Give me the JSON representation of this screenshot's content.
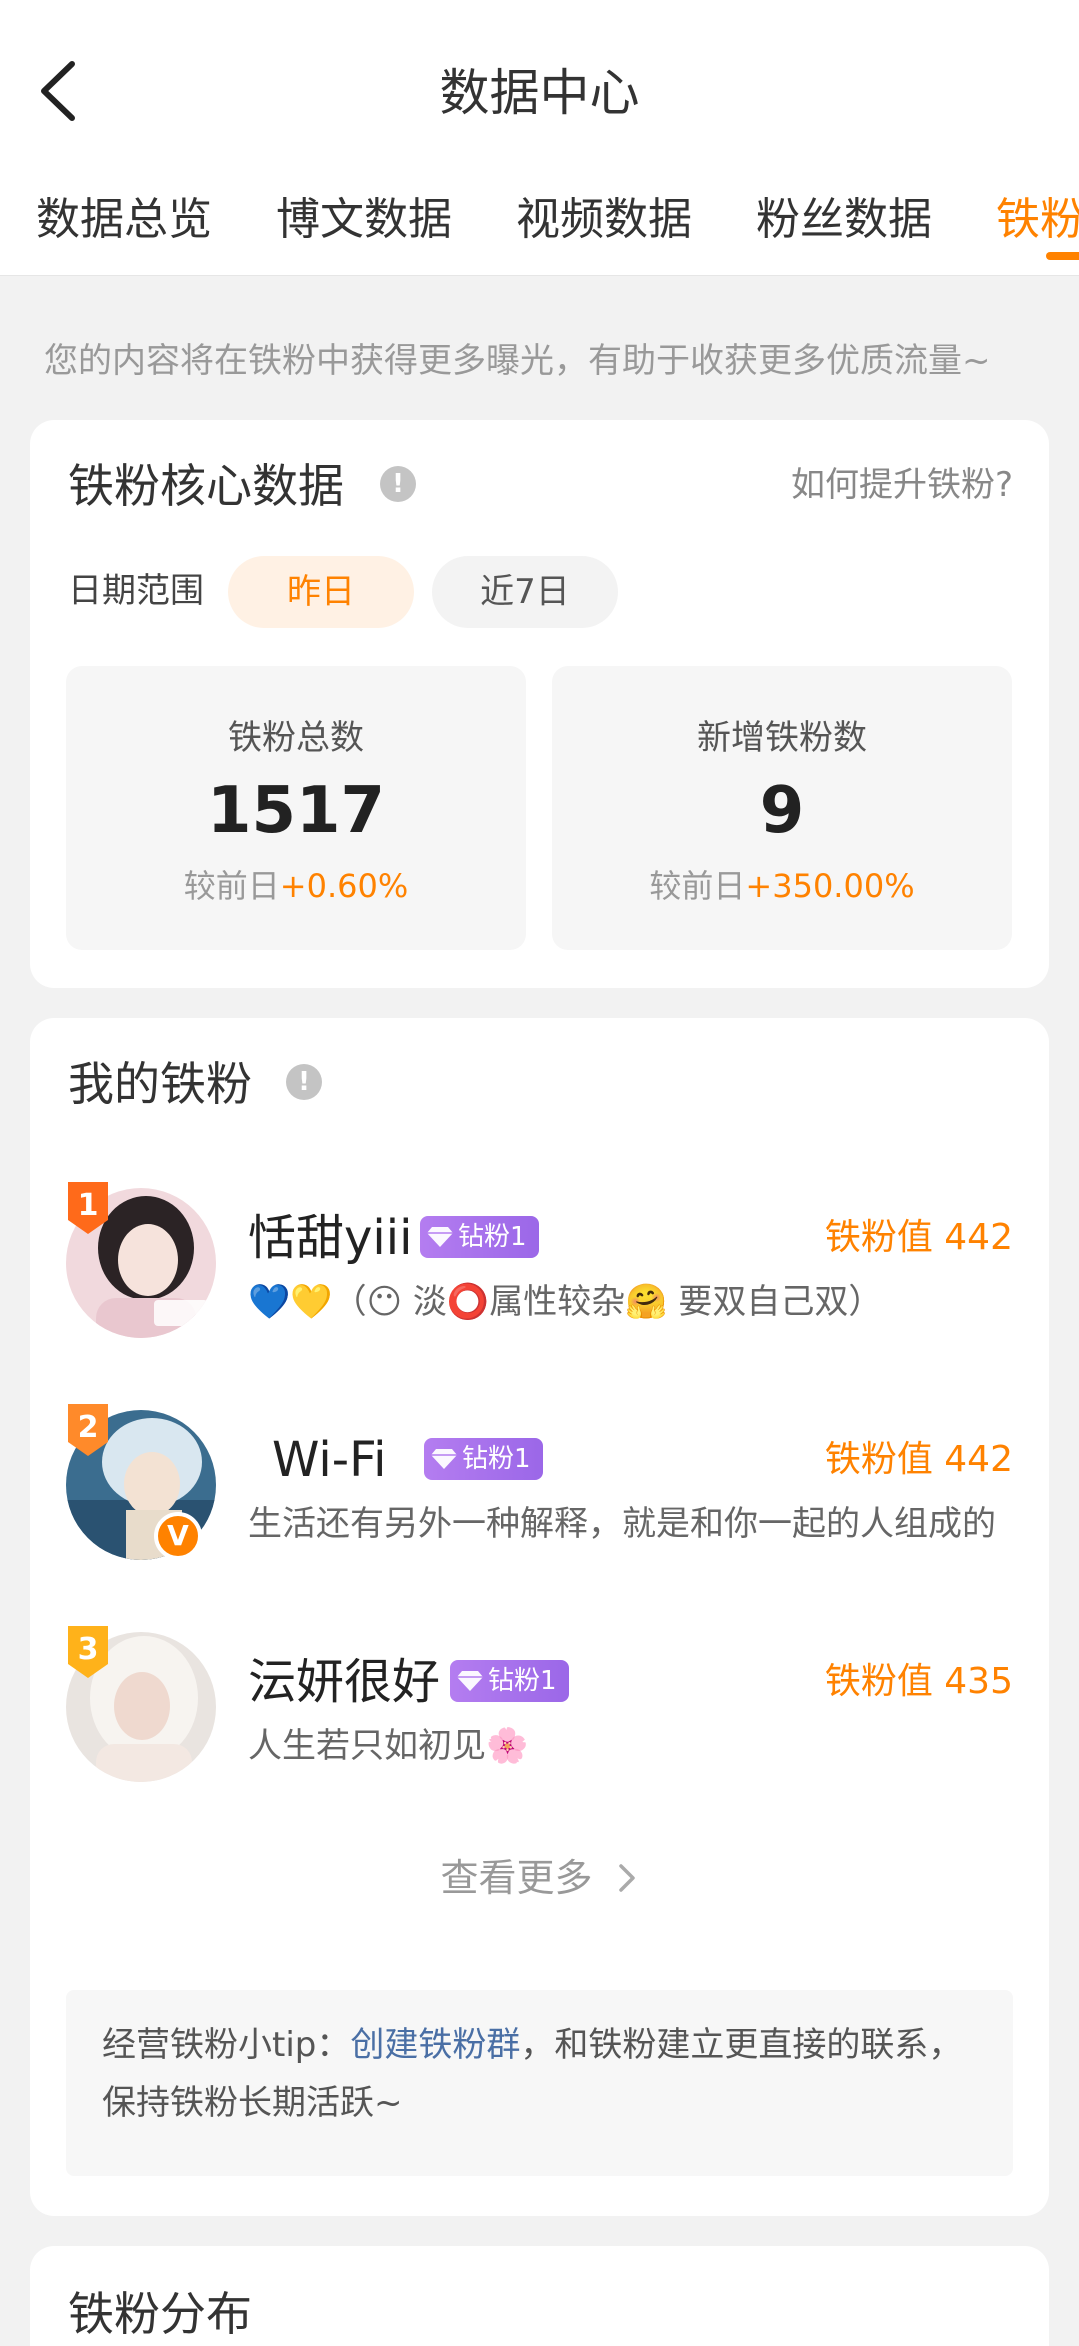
{
  "header": {
    "title": "数据中心"
  },
  "tabs": [
    {
      "label": "数据总览"
    },
    {
      "label": "博文数据"
    },
    {
      "label": "视频数据"
    },
    {
      "label": "粉丝数据"
    },
    {
      "label": "铁粉"
    }
  ],
  "notice": "您的内容将在铁粉中获得更多曝光，有助于收获更多优质流量~",
  "core": {
    "title": "铁粉核心数据",
    "info_glyph": "!",
    "how_link": "如何提升铁粉?",
    "range_label": "日期范围",
    "range_options": [
      "昨日",
      "近7日"
    ],
    "stats": [
      {
        "label": "铁粉总数",
        "value": "1517",
        "delta_prefix": "较前日",
        "delta": "+0.60%"
      },
      {
        "label": "新增铁粉数",
        "value": "9",
        "delta_prefix": "较前日",
        "delta": "+350.00%"
      }
    ]
  },
  "my_fans": {
    "title": "我的铁粉",
    "info_glyph": "!",
    "items": [
      {
        "rank": "1",
        "name": "恬甜yiii",
        "level": "钻粉1",
        "value": "铁粉值 442",
        "signature": "💙💛（😶 淡⭕属性较杂🤗 要双自己双）"
      },
      {
        "rank": "2",
        "name": "Wi-Fi",
        "level": "钻粉1",
        "value": "铁粉值 442",
        "signature": "生活还有另外一种解释，就是和你一起的人组成的",
        "verified": "V"
      },
      {
        "rank": "3",
        "name": "沄妍很好",
        "level": "钻粉1",
        "value": "铁粉值 435",
        "signature": "人生若只如初见🌸"
      }
    ],
    "more": "查看更多",
    "tip_prefix": "经营铁粉小tip：",
    "tip_link": "创建铁粉群",
    "tip_suffix": "，和铁粉建立更直接的联系，保持铁粉长期活跃~"
  },
  "distribution": {
    "title": "铁粉分布"
  },
  "colors": {
    "accent": "#ff8200",
    "link": "#4a6fa5",
    "level_badge": "#9b67e8"
  }
}
